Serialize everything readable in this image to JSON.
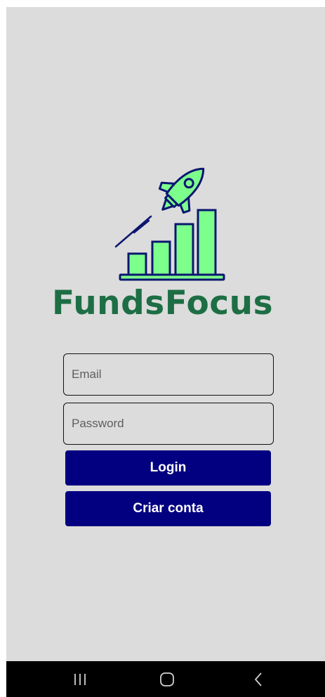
{
  "app": {
    "name": "FundsFocus",
    "logo_icon": "rocket-bar-chart-icon",
    "logo_fill_color": "#7dff8c",
    "logo_stroke_color": "#0b1670",
    "brand_color": "#1d6e44"
  },
  "form": {
    "email": {
      "placeholder": "Email",
      "value": ""
    },
    "password": {
      "placeholder": "Password",
      "value": ""
    }
  },
  "buttons": {
    "login_label": "Login",
    "create_account_label": "Criar conta",
    "color": "#020080"
  },
  "navbar": {
    "background": "#000000",
    "items": [
      {
        "icon": "recent-apps-icon"
      },
      {
        "icon": "home-icon"
      },
      {
        "icon": "back-icon"
      }
    ]
  }
}
